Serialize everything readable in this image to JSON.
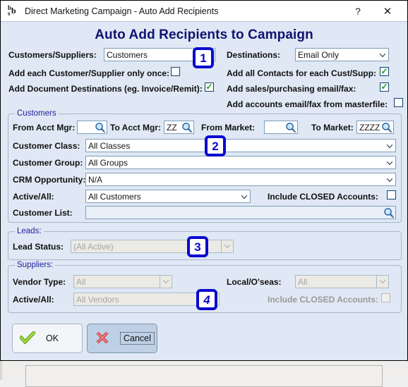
{
  "window": {
    "title": "Direct Marketing Campaign - Auto Add Recipients",
    "icon_name": "bsb-app-icon",
    "icon_glyph_1": "b",
    "icon_glyph_2": "b",
    "icon_glyph_3": "s",
    "help_label": "?",
    "close_label": "✕",
    "heading": "Auto Add Recipients to Campaign",
    "accent_color": "#121270",
    "badge_color": "#0909cf",
    "background_color": "#dfe8f4"
  },
  "top": {
    "customers_suppliers_label": "Customers/Suppliers:",
    "customers_suppliers_value": "Customers",
    "destinations_label": "Destinations:",
    "destinations_value": "Email Only",
    "add_once_label": "Add each Customer/Supplier only once:",
    "add_once_checked": false,
    "add_all_contacts_label": "Add all Contacts for each Cust/Supp:",
    "add_all_contacts_checked": true,
    "add_doc_destinations_label": "Add Document Destinations (eg. Invoice/Remit):",
    "add_doc_destinations_checked": true,
    "add_sales_email_label": "Add sales/purchasing email/fax:",
    "add_sales_email_checked": true,
    "add_accounts_email_label": "Add accounts email/fax from masterfile:",
    "add_accounts_email_checked": false
  },
  "customers": {
    "legend": "Customers",
    "from_acct_mgr_label": "From Acct Mgr:",
    "from_acct_mgr_value": "",
    "to_acct_mgr_label": "To Acct Mgr:",
    "to_acct_mgr_value": "ZZ",
    "from_market_label": "From Market:",
    "from_market_value": "",
    "to_market_label": "To Market:",
    "to_market_value": "ZZZZ",
    "customer_class_label": "Customer Class:",
    "customer_class_value": "All Classes",
    "customer_group_label": "Customer Group:",
    "customer_group_value": "All Groups",
    "crm_opportunity_label": "CRM Opportunity:",
    "crm_opportunity_value": "N/A",
    "active_all_label": "Active/All:",
    "active_all_value": "All Customers",
    "include_closed_label": "Include CLOSED Accounts:",
    "include_closed_checked": false,
    "customer_list_label": "Customer List:",
    "customer_list_value": ""
  },
  "leads": {
    "legend": "Leads:",
    "lead_status_label": "Lead Status:",
    "lead_status_value": "(All Active)"
  },
  "suppliers": {
    "legend": "Suppliers:",
    "vendor_type_label": "Vendor Type:",
    "vendor_type_value": "All",
    "local_overseas_label": "Local/O'seas:",
    "local_overseas_value": "All",
    "active_all_label": "Active/All:",
    "active_all_value": "All Vendors",
    "include_closed_label": "Include CLOSED Accounts:",
    "include_closed_checked": false
  },
  "actions": {
    "ok_label": "OK",
    "ok_icon": "green-tick-icon",
    "cancel_label": "Cancel",
    "cancel_icon": "red-cross-icon"
  },
  "badges": {
    "b1": "1",
    "b2": "2",
    "b3": "3",
    "b4": "4"
  }
}
